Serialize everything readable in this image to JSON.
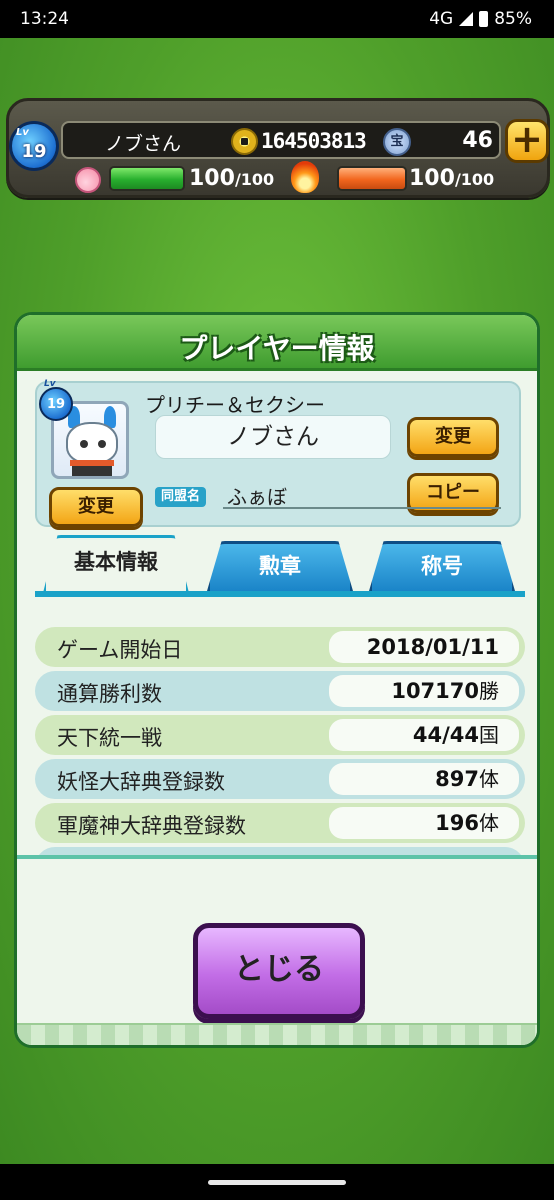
{
  "status_bar": {
    "time": "13:24",
    "network": "4G",
    "battery": "85%"
  },
  "hud": {
    "level_label": "Lv",
    "level": "19",
    "player_name": "ノブさん",
    "money": "164503813",
    "treasure_icon_text": "宝",
    "treasure_count": "46",
    "plus_label": "+",
    "hp_value": "100",
    "hp_max": "/100",
    "hp_fraction": 1.0,
    "sp_value": "100",
    "sp_max": "/100",
    "sp_fraction": 1.0
  },
  "panel": {
    "title": "プレイヤー情報",
    "avatar_level": "19",
    "avatar_level_label": "Lv",
    "player_title": "プリチー＆セクシー",
    "player_name": "ノブさん",
    "change_name_label": "変更",
    "change_avatar_label": "変更",
    "copy_label": "コピー",
    "alliance_tag": "同盟名",
    "alliance_name": "ふぁぼ",
    "tabs": [
      {
        "label": "基本情報",
        "active": true
      },
      {
        "label": "勲章",
        "active": false
      },
      {
        "label": "称号",
        "active": false
      }
    ],
    "stats": [
      {
        "label": "ゲーム開始日",
        "value": "2018/01/11",
        "unit": ""
      },
      {
        "label": "通算勝利数",
        "value": "107170",
        "unit": "勝"
      },
      {
        "label": "天下統一戦",
        "value": "44/44",
        "unit": "国"
      },
      {
        "label": "妖怪大辞典登録数",
        "value": "897",
        "unit": "体"
      },
      {
        "label": "軍魔神大辞典登録数",
        "value": "196",
        "unit": "体"
      }
    ],
    "close_label": "とじる"
  }
}
